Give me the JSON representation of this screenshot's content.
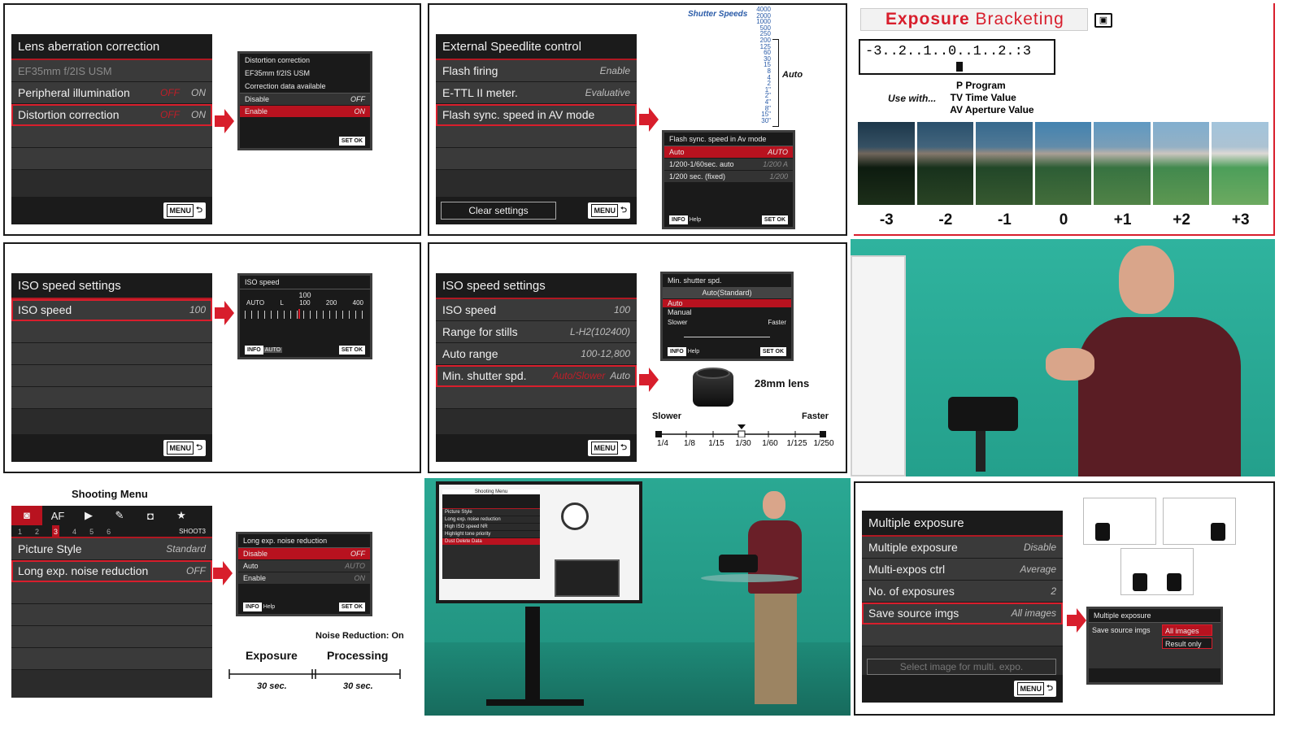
{
  "panel1": {
    "title": "Lens aberration correction",
    "lens": "EF35mm f/2IS USM",
    "rows": [
      {
        "label": "Peripheral illumination",
        "off": "OFF",
        "on": "ON"
      },
      {
        "label": "Distortion correction",
        "off": "OFF",
        "on": "ON"
      }
    ],
    "menu": "MENU",
    "popup": {
      "title": "Distortion correction",
      "lens": "EF35mm f/2IS USM",
      "status": "Correction data available",
      "opt1": "Disable",
      "opt1v": "OFF",
      "opt2": "Enable",
      "opt2v": "ON",
      "set": "SET",
      "ok": "OK"
    }
  },
  "panel2": {
    "title": "External Speedlite control",
    "rows": [
      {
        "label": "Flash firing",
        "val": "Enable"
      },
      {
        "label": "E-TTL II meter.",
        "val": "Evaluative"
      },
      {
        "label": "Flash sync. speed in AV mode",
        "val": ""
      }
    ],
    "clear": "Clear settings",
    "menu": "MENU",
    "shutter_title": "Shutter Speeds",
    "speeds": [
      "4000",
      "2000",
      "1000",
      "500",
      "250",
      "200",
      "125",
      "60",
      "30",
      "15",
      "8",
      "4",
      "2",
      "1\"",
      "2\"",
      "4\"",
      "8\"",
      "15\"",
      "30\""
    ],
    "auto": "Auto",
    "popup": {
      "title": "Flash sync. speed in Av mode",
      "o1": "Auto",
      "o1v": "AUTO",
      "o2": "1/200-1/60sec. auto",
      "o2v": "1/200 A",
      "o3": "1/200 sec. (fixed)",
      "o3v": "1/200",
      "info": "INFO",
      "help": "Help",
      "set": "SET",
      "ok": "OK"
    }
  },
  "panel3": {
    "title_a": "Exposure",
    "title_b": "Bracketing",
    "scale": "-3..2..1..0..1..2.:3",
    "use_with": "Use with...",
    "modes": [
      {
        "code": "P",
        "name": "Program"
      },
      {
        "code": "TV",
        "name": "Time Value"
      },
      {
        "code": "AV",
        "name": "Aperture Value"
      }
    ],
    "labels": [
      "-3",
      "-2",
      "-1",
      "0",
      "+1",
      "+2",
      "+3"
    ]
  },
  "panel4": {
    "title": "ISO speed settings",
    "row": "ISO speed",
    "val": "100",
    "menu": "MENU",
    "popup": {
      "title": "ISO speed",
      "cur": "100",
      "ticks": [
        "AUTO",
        "L",
        "100",
        "200",
        "400"
      ],
      "info": "INFO",
      "auto": "AUTO",
      "set": "SET",
      "ok": "OK"
    }
  },
  "panel5": {
    "title": "ISO speed settings",
    "rows": [
      {
        "label": "ISO speed",
        "val": "100"
      },
      {
        "label": "Range for stills",
        "val": "L-H2(102400)"
      },
      {
        "label": "Auto range",
        "val": "100-12,800"
      },
      {
        "label": "Min. shutter spd.",
        "val": "Auto",
        "extra": "Auto/Slower"
      }
    ],
    "menu": "MENU",
    "popup": {
      "title": "Min. shutter spd.",
      "header": "Auto(Standard)",
      "o1": "Auto",
      "o2": "Manual",
      "slower": "Slower",
      "faster": "Faster",
      "info": "INFO",
      "help": "Help",
      "set": "SET",
      "ok": "OK"
    },
    "lens_label": "28mm lens",
    "slower": "Slower",
    "faster": "Faster",
    "scale": [
      "1/4",
      "1/8",
      "1/15",
      "1/30",
      "1/60",
      "1/125",
      "1/250"
    ]
  },
  "panel7": {
    "heading": "Shooting Menu",
    "tabs": [
      "AF"
    ],
    "nums": [
      "1",
      "2",
      "3",
      "4",
      "5",
      "6"
    ],
    "shoot": "SHOOT3",
    "rows": [
      {
        "label": "Picture Style",
        "val": "Standard"
      },
      {
        "label": "Long exp. noise reduction",
        "val": "OFF"
      }
    ],
    "popup": {
      "title": "Long exp. noise reduction",
      "o1": "Disable",
      "o1v": "OFF",
      "o2": "Auto",
      "o2v": "AUTO",
      "o3": "Enable",
      "o3v": "ON",
      "info": "INFO",
      "help": "Help",
      "set": "SET",
      "ok": "OK"
    },
    "nr": "Noise Reduction: On",
    "exposure": "Exposure",
    "processing": "Processing",
    "t1": "30 sec.",
    "t2": "30 sec."
  },
  "panel8": {
    "screen_title": "Shooting Menu",
    "rows": [
      "Picture Style",
      "Long exp. noise reduction",
      "High ISO speed NR",
      "Highlight tone priority",
      "Dust Delete Data"
    ]
  },
  "panel9": {
    "title": "Multiple exposure",
    "rows": [
      {
        "label": "Multiple exposure",
        "val": "Disable"
      },
      {
        "label": "Multi-expos ctrl",
        "val": "Average"
      },
      {
        "label": "No. of exposures",
        "val": "2"
      },
      {
        "label": "Save source imgs",
        "val": "All images"
      }
    ],
    "select": "Select image for multi. expo.",
    "menu": "MENU",
    "popup": {
      "title": "Multiple exposure",
      "label": "Save source imgs",
      "o1": "All images",
      "o2": "Result only"
    }
  }
}
